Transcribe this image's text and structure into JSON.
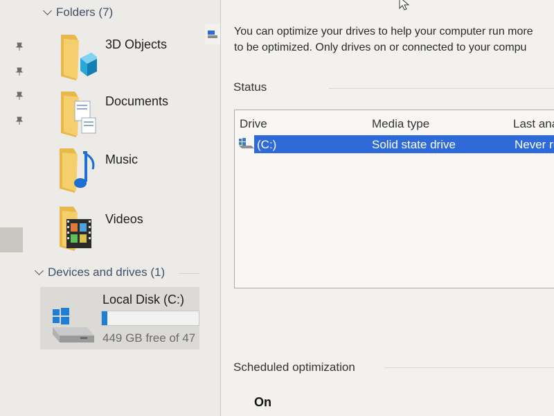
{
  "explorer": {
    "folders_group": {
      "label": "Folders (7)"
    },
    "folders": [
      {
        "label": "3D Objects",
        "icon": "3d-objects-folder-icon"
      },
      {
        "label": "Documents",
        "icon": "documents-folder-icon"
      },
      {
        "label": "Music",
        "icon": "music-folder-icon"
      },
      {
        "label": "Videos",
        "icon": "videos-folder-icon"
      }
    ],
    "devices_group": {
      "label": "Devices and drives (1)"
    },
    "drive": {
      "label": "Local Disk (C:)",
      "free_text": "449 GB free of 47",
      "used_fraction": 0.06,
      "icon": "hard-drive-icon"
    }
  },
  "optimize": {
    "description_line1": "You can optimize your drives to help your computer run more",
    "description_line2": "to be optimized. Only drives on or connected to your compu",
    "status_label": "Status",
    "columns": {
      "drive": "Drive",
      "media_type": "Media type",
      "last_analyzed": "Last ana"
    },
    "rows": [
      {
        "drive": "(C:)",
        "media_type": "Solid state drive",
        "last_analyzed": "Never ru"
      }
    ],
    "scheduled_label": "Scheduled optimization",
    "scheduled_state": "On"
  },
  "colors": {
    "selection": "#2f6bd8",
    "drive_fill": "#1e7fd6",
    "folder_yellow": "#f2c75c"
  }
}
